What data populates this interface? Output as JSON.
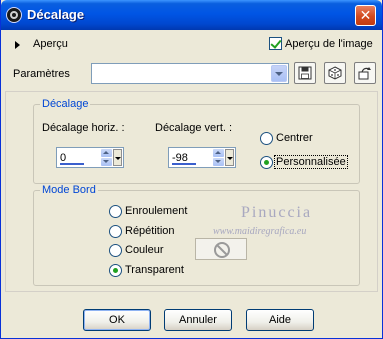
{
  "window": {
    "title": "Décalage",
    "close_glyph": "✕"
  },
  "preview": {
    "label": "Aperçu",
    "image_preview_label": "Aperçu de l'image",
    "image_preview_checked": true
  },
  "params": {
    "label": "Paramètres",
    "value": ""
  },
  "offset_group": {
    "title": "Décalage",
    "horiz_label": "Décalage horiz. :",
    "horiz_value": "0",
    "vert_label": "Décalage vert. :",
    "vert_value": "-98",
    "options": [
      {
        "label": "Centrer",
        "selected": false
      },
      {
        "label": "Personnalisée",
        "selected": true
      }
    ]
  },
  "edge_group": {
    "title": "Mode Bord",
    "options": [
      {
        "label": "Enroulement",
        "selected": false
      },
      {
        "label": "Répétition",
        "selected": false
      },
      {
        "label": "Couleur",
        "selected": false
      },
      {
        "label": "Transparent",
        "selected": true
      }
    ]
  },
  "watermark": {
    "name": "Pinuccia",
    "url": "www.maidiregrafica.eu"
  },
  "buttons": {
    "ok": "OK",
    "cancel": "Annuler",
    "help": "Aide"
  },
  "colors": {
    "title_bar": "#0055e5",
    "group_title": "#0046d5",
    "radio_dot": "#21a121",
    "background": "#ece9d8"
  }
}
